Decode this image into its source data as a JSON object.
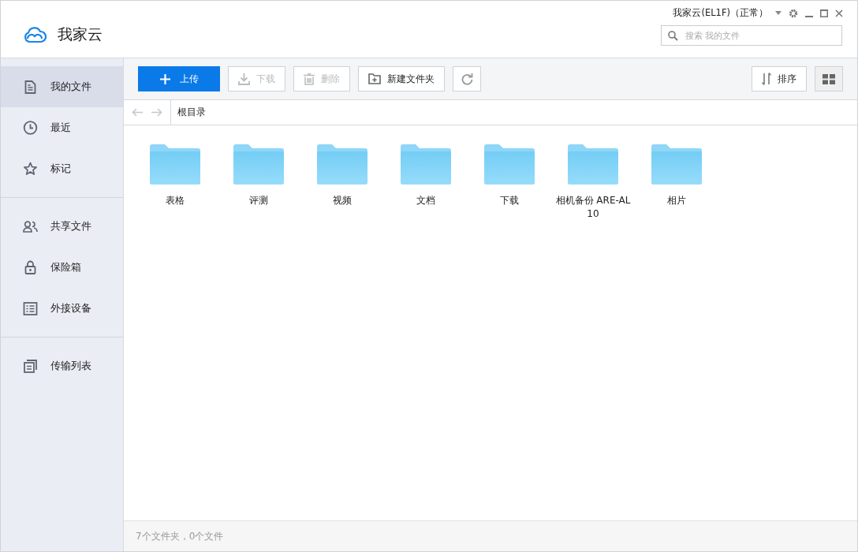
{
  "app": {
    "name": "我家云",
    "account": "我家云(EL1F)（正常）"
  },
  "search": {
    "placeholder": "搜索 我的文件"
  },
  "sidebar": {
    "groups": [
      [
        {
          "label": "我的文件",
          "kind": "file",
          "selected": true
        },
        {
          "label": "最近",
          "kind": "clock",
          "selected": false
        },
        {
          "label": "标记",
          "kind": "star",
          "selected": false
        }
      ],
      [
        {
          "label": "共享文件",
          "kind": "people",
          "selected": false
        },
        {
          "label": "保险箱",
          "kind": "lock",
          "selected": false
        },
        {
          "label": "外接设备",
          "kind": "list",
          "selected": false
        }
      ],
      [
        {
          "label": "传输列表",
          "kind": "transfer",
          "selected": false
        }
      ]
    ]
  },
  "toolbar": {
    "buttons": [
      {
        "label": "上传",
        "kind": "upload",
        "disabled": false
      },
      {
        "label": "下载",
        "kind": "download",
        "disabled": true
      },
      {
        "label": "删除",
        "kind": "delete",
        "disabled": true
      },
      {
        "label": "新建文件夹",
        "kind": "newfolder",
        "disabled": false
      },
      {
        "kind": "refresh",
        "disabled": false
      }
    ],
    "sort": "排序"
  },
  "breadcrumb": {
    "path": "根目录"
  },
  "folders": [
    "表格",
    "评测",
    "视频",
    "文档",
    "下载",
    "相机备份 ARE-AL10",
    "相片"
  ],
  "status_bar": "7个文件夹，0个文件"
}
